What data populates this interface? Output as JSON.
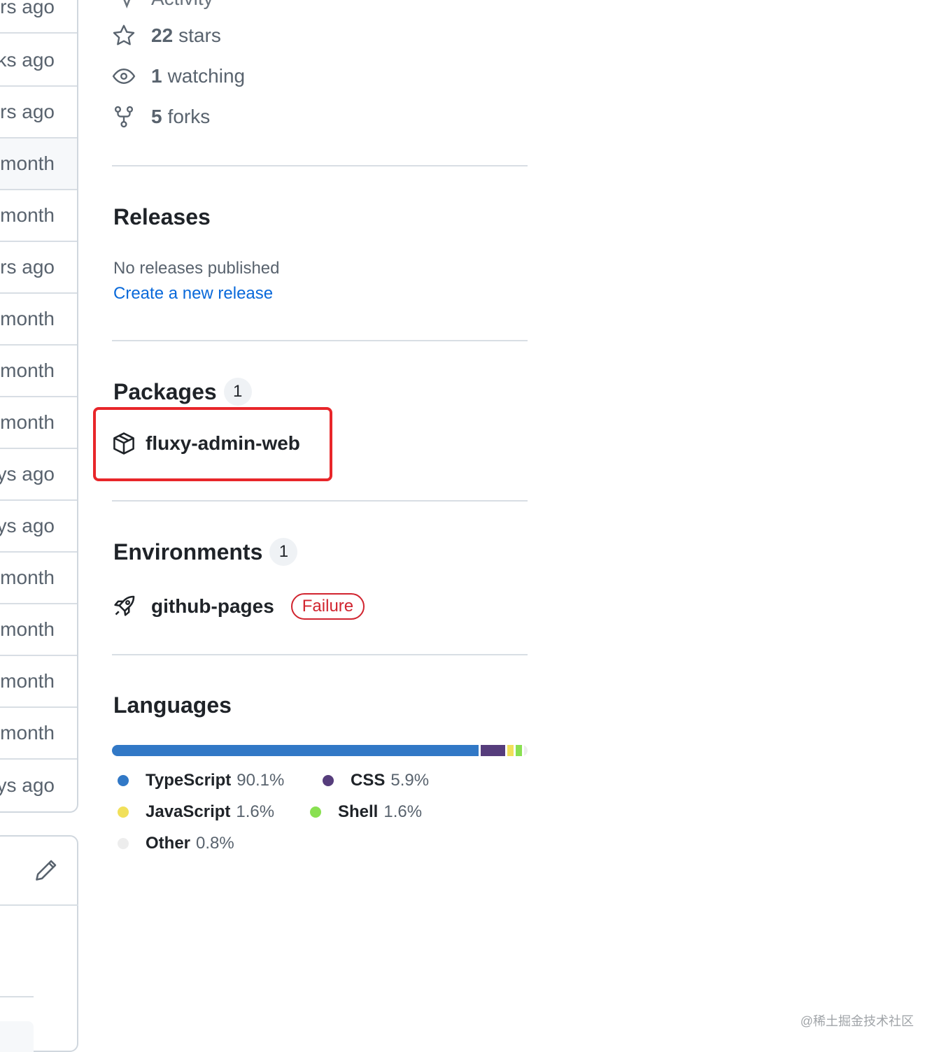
{
  "file_list": {
    "ages": [
      "rs ago",
      "ks ago",
      "rs ago",
      "month",
      "month",
      "rs ago",
      "month",
      "month",
      "month",
      "ys ago",
      "ys ago",
      "month",
      "month",
      "month",
      "month",
      "ys ago"
    ]
  },
  "about": {
    "activity_label": "Activity",
    "stars": {
      "count": "22",
      "label": "stars"
    },
    "watching": {
      "count": "1",
      "label": "watching"
    },
    "forks": {
      "count": "5",
      "label": "forks"
    }
  },
  "releases": {
    "title": "Releases",
    "empty_text": "No releases published",
    "create_link": "Create a new release"
  },
  "packages": {
    "title": "Packages",
    "count": "1",
    "items": [
      {
        "name": "fluxy-admin-web"
      }
    ],
    "highlight_color": "#e8262a"
  },
  "environments": {
    "title": "Environments",
    "count": "1",
    "items": [
      {
        "name": "github-pages",
        "status": "Failure"
      }
    ]
  },
  "languages": {
    "title": "Languages",
    "items": [
      {
        "name": "TypeScript",
        "percent_text": "90.1%",
        "percent": 90.1,
        "color": "#3178c6"
      },
      {
        "name": "CSS",
        "percent_text": "5.9%",
        "percent": 5.9,
        "color": "#563d7c"
      },
      {
        "name": "JavaScript",
        "percent_text": "1.6%",
        "percent": 1.6,
        "color": "#f1e05a"
      },
      {
        "name": "Shell",
        "percent_text": "1.6%",
        "percent": 1.6,
        "color": "#89e051"
      },
      {
        "name": "Other",
        "percent_text": "0.8%",
        "percent": 0.8,
        "color": "#ededed"
      }
    ]
  },
  "icons": {
    "stars": "star-icon",
    "watching": "eye-icon",
    "forks": "fork-icon",
    "package": "package-icon",
    "environment": "rocket-icon",
    "edit": "pencil-icon"
  },
  "watermark": "@稀土掘金技术社区"
}
